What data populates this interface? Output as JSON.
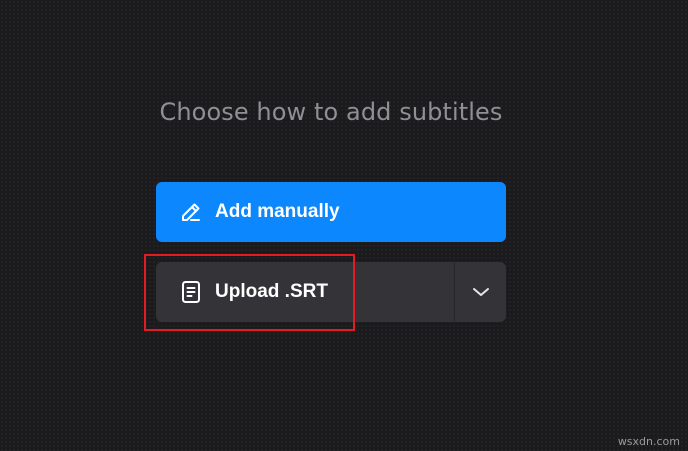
{
  "header": {
    "title": "Choose how to add subtitles"
  },
  "actions": {
    "add_manually": {
      "label": "Add manually",
      "icon": "pencil-icon",
      "color": "#0d87fe"
    },
    "upload_srt": {
      "label": "Upload .SRT",
      "icon": "document-icon",
      "color": "#343438"
    },
    "more_options": {
      "icon": "chevron-down-icon"
    }
  },
  "annotation": {
    "highlight_color": "#e31b23"
  },
  "watermark": {
    "text": "wsxdn.com"
  }
}
